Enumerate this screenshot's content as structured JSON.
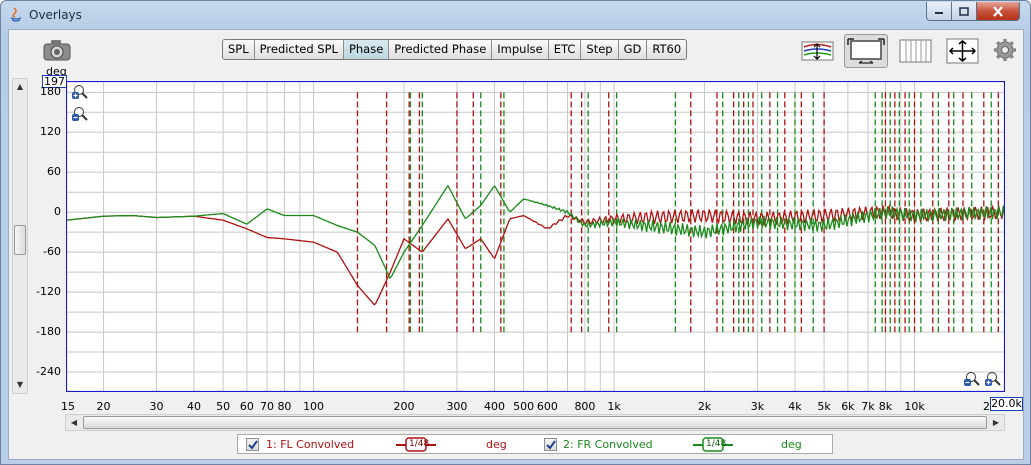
{
  "window": {
    "title": "Overlays"
  },
  "tabs": [
    {
      "label": "SPL",
      "active": false
    },
    {
      "label": "Predicted SPL",
      "active": false
    },
    {
      "label": "Phase",
      "active": true
    },
    {
      "label": "Predicted Phase",
      "active": false
    },
    {
      "label": "Impulse",
      "active": false
    },
    {
      "label": "ETC",
      "active": false
    },
    {
      "label": "Step",
      "active": false
    },
    {
      "label": "GD",
      "active": false
    },
    {
      "label": "RT60",
      "active": false
    }
  ],
  "toolbar": {
    "icons": [
      "camera-icon",
      "traces-arrange-icon",
      "graph-view-icon",
      "grid-lines-icon",
      "move-arrows-icon",
      "gear-icon"
    ]
  },
  "axis": {
    "y_unit": "deg",
    "y_top_value": "197",
    "y_ticks": [
      "180",
      "120",
      "60",
      "0",
      "-60",
      "-120",
      "-180",
      "-240"
    ],
    "x_ticks": [
      "15",
      "20",
      "30",
      "40",
      "50",
      "60",
      "70",
      "80",
      "100",
      "200",
      "300",
      "400",
      "500",
      "600",
      "800",
      "1k",
      "2k",
      "3k",
      "4k",
      "5k",
      "6k",
      "7k",
      "8k",
      "10k",
      "20"
    ],
    "x_end_value": "20.0k"
  },
  "colors": {
    "fl": "#b01010",
    "fr": "#1a8a1a",
    "grid": "#c8c8c8",
    "frame": "#1a1acc"
  },
  "legend": [
    {
      "label": "1: FL Convolved",
      "smoothing": "1/48",
      "unit": "deg",
      "checked": true,
      "color": "#b01010"
    },
    {
      "label": "2: FR Convolved",
      "smoothing": "1/48",
      "unit": "deg",
      "checked": true,
      "color": "#1a8a1a"
    }
  ],
  "chart_data": {
    "type": "line",
    "title": "",
    "xlabel": "",
    "ylabel": "deg",
    "x_scale": "log",
    "xlim": [
      15,
      20000
    ],
    "ylim": [
      -270,
      197
    ],
    "grid": true,
    "series": [
      {
        "name": "1: FL Convolved",
        "x": [
          15,
          20,
          25,
          30,
          40,
          50,
          60,
          70,
          80,
          100,
          120,
          140,
          160,
          180,
          200,
          230,
          280,
          320,
          360,
          400,
          450,
          500,
          600,
          700,
          800,
          1000,
          2000,
          3000,
          5000,
          8000,
          10000,
          20000
        ],
        "y": [
          -12,
          -6,
          -5,
          -8,
          -6,
          -12,
          -25,
          -38,
          -40,
          -45,
          -60,
          -110,
          -140,
          -90,
          -40,
          -60,
          -10,
          -55,
          -40,
          -70,
          -10,
          -5,
          -25,
          -5,
          -15,
          -10,
          -5,
          -10,
          -5,
          0,
          -5,
          0
        ]
      },
      {
        "name": "2: FR Convolved",
        "x": [
          15,
          20,
          25,
          30,
          40,
          50,
          60,
          70,
          80,
          100,
          120,
          140,
          160,
          180,
          200,
          230,
          280,
          320,
          360,
          400,
          450,
          500,
          600,
          700,
          800,
          1000,
          2000,
          3000,
          5000,
          8000,
          10000,
          20000
        ],
        "y": [
          -12,
          -6,
          -5,
          -8,
          -6,
          -2,
          -18,
          5,
          -5,
          -5,
          -20,
          -30,
          -50,
          -100,
          -60,
          -20,
          40,
          -10,
          10,
          40,
          0,
          20,
          10,
          0,
          -20,
          -15,
          -30,
          -15,
          -20,
          0,
          -5,
          0
        ]
      }
    ],
    "wrap_frequencies": {
      "FL Convolved": [
        140,
        175,
        208,
        225,
        300,
        340,
        420,
        720,
        780,
        960,
        1800,
        2200,
        2500,
        2700,
        2900,
        3300,
        3700,
        4200,
        5000,
        8000,
        8600,
        9300,
        10000,
        11500,
        13000,
        14500,
        17000,
        19000
      ],
      "FR Convolved": [
        210,
        230,
        360,
        430,
        820,
        1020,
        1600,
        2300,
        2600,
        2800,
        3100,
        3500,
        4000,
        4600,
        7400,
        7800,
        8300,
        8900,
        9600,
        10500,
        12000,
        13500,
        15500,
        18000
      ]
    }
  }
}
